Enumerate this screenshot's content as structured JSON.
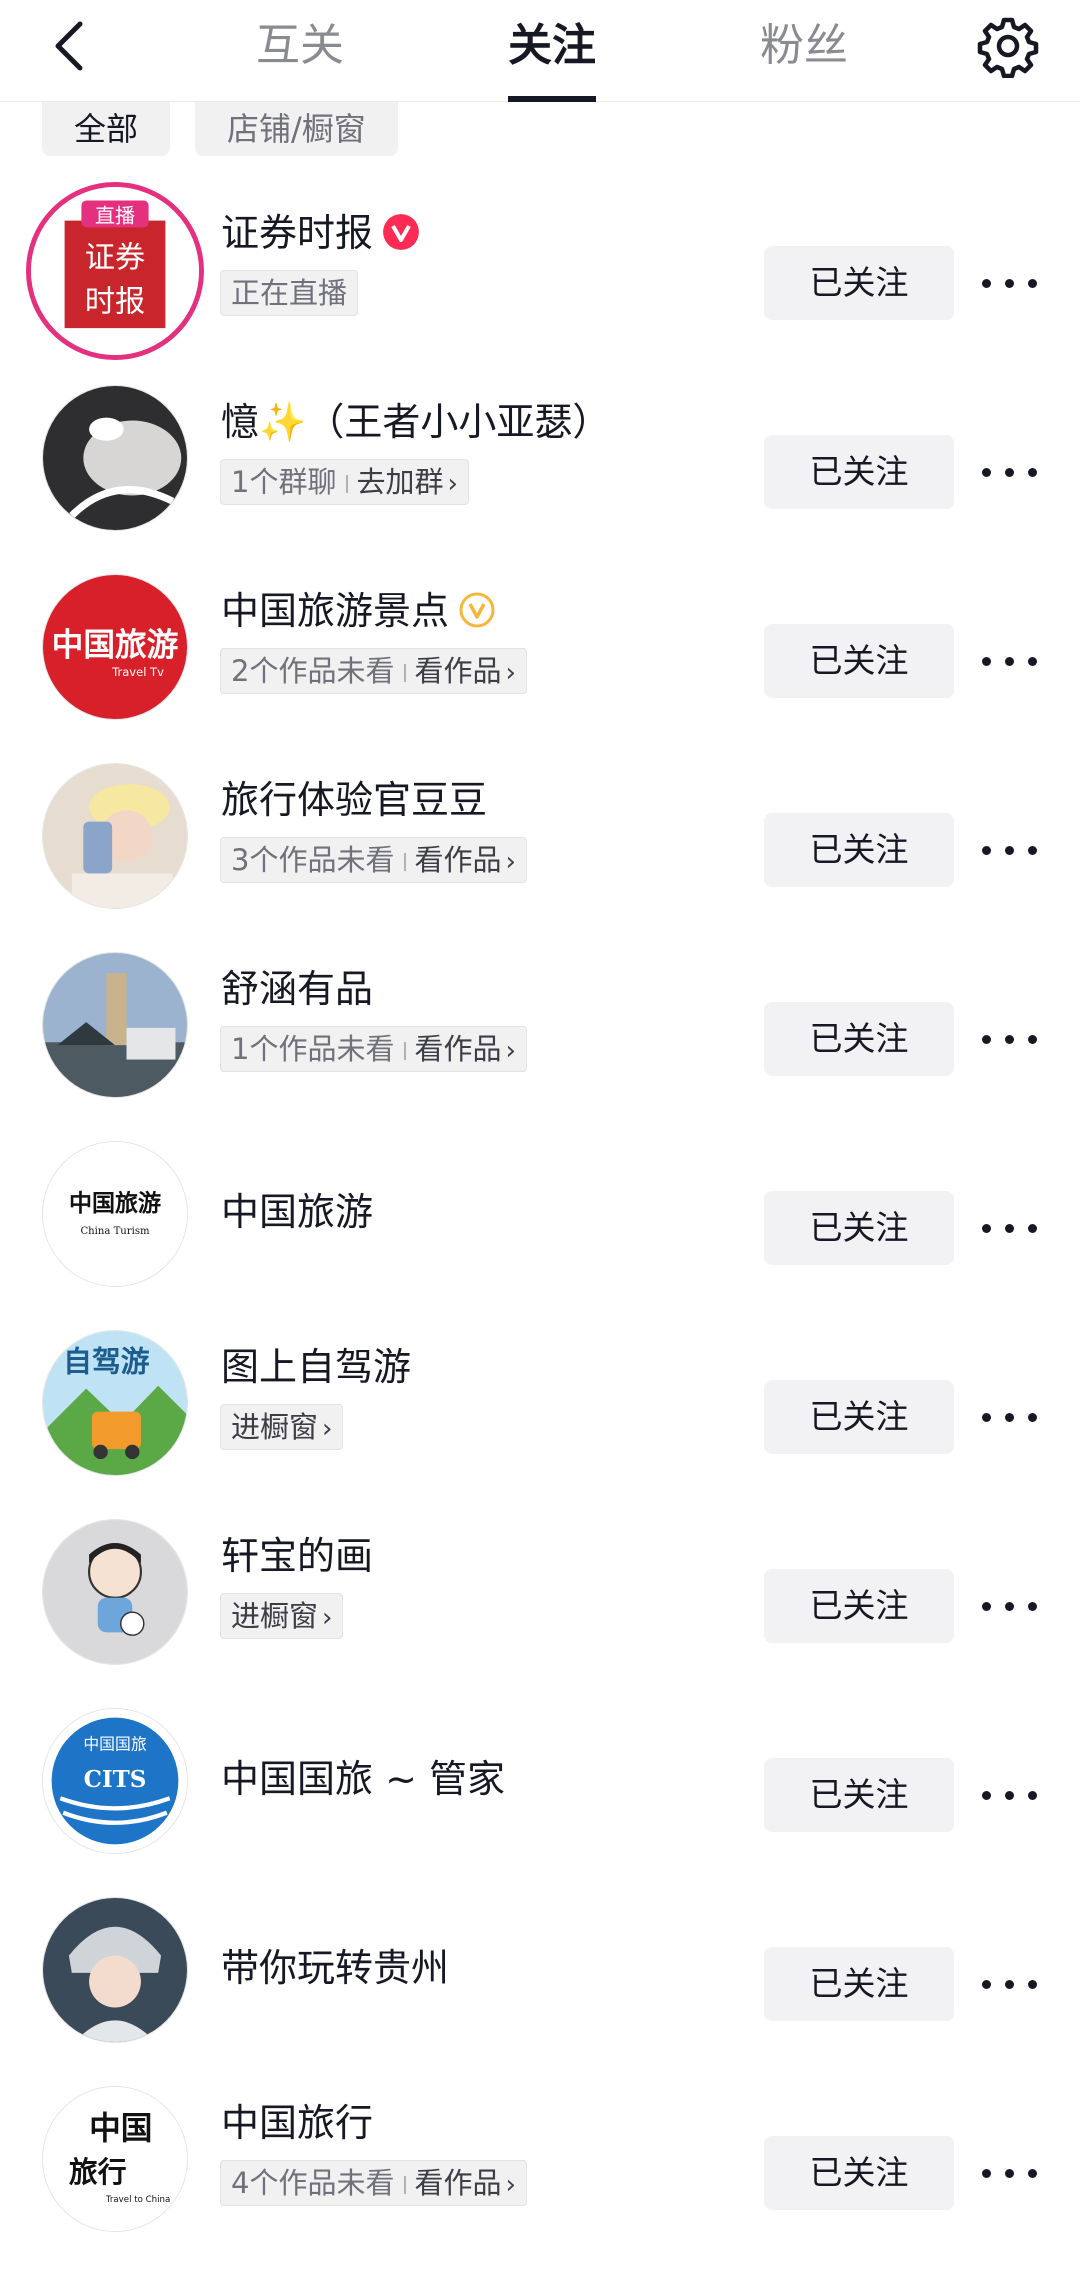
{
  "header": {
    "tabs": [
      "互关",
      "关注",
      "粉丝"
    ],
    "active_tab": "关注"
  },
  "filters": [
    "全部",
    "店铺/橱窗"
  ],
  "follow_label": "已关注",
  "rows": [
    {
      "name": "证券时报",
      "badge": "red-verified",
      "sub": {
        "text": "正在直播"
      },
      "avatar_text": [
        "直播",
        "证券",
        "时报"
      ],
      "colors": [
        "#c8262c",
        "#e5307f"
      ]
    },
    {
      "name": "憶✨（王者小小亚瑟）",
      "sub": {
        "text": "1个群聊",
        "link": "去加群"
      },
      "colors": [
        "#2e2e31",
        "#d8d6d4"
      ]
    },
    {
      "name": "中国旅游景点",
      "badge": "gold-verified",
      "sub": {
        "text": "2个作品未看",
        "link": "看作品"
      },
      "avatar_text": [
        "中国旅游",
        "Travel Tv"
      ],
      "colors": [
        "#d8202a",
        "#ffffff"
      ]
    },
    {
      "name": "旅行体验官豆豆",
      "sub": {
        "text": "3个作品未看",
        "link": "看作品"
      },
      "colors": [
        "#e6dccf",
        "#8ba4c9"
      ]
    },
    {
      "name": "舒涵有品",
      "sub": {
        "text": "1个作品未看",
        "link": "看作品"
      },
      "colors": [
        "#9bb3cf",
        "#4e5a62"
      ]
    },
    {
      "name": "中国旅游",
      "avatar_text": [
        "中国旅游",
        "China Turism"
      ],
      "colors": [
        "#ffffff",
        "#111111"
      ]
    },
    {
      "name": "图上自驾游",
      "sub": {
        "link": "进橱窗"
      },
      "avatar_text": [
        "自驾游"
      ],
      "colors": [
        "#bfe3f4",
        "#5aa846"
      ]
    },
    {
      "name": "轩宝的画",
      "sub": {
        "link": "进橱窗"
      },
      "colors": [
        "#d9d9db",
        "#6ea6dc"
      ]
    },
    {
      "name": "中国国旅 ~ 管家",
      "avatar_text": [
        "中国国旅",
        "CITS"
      ],
      "colors": [
        "#ffffff",
        "#1e74c6"
      ]
    },
    {
      "name": "带你玩转贵州",
      "colors": [
        "#3b4a58",
        "#cfd4d9"
      ]
    },
    {
      "name": "中国旅行",
      "sub": {
        "text": "4个作品未看",
        "link": "看作品"
      },
      "avatar_text": [
        "中国",
        "旅行",
        "Travel to China"
      ],
      "colors": [
        "#ffffff",
        "#111111"
      ]
    }
  ]
}
